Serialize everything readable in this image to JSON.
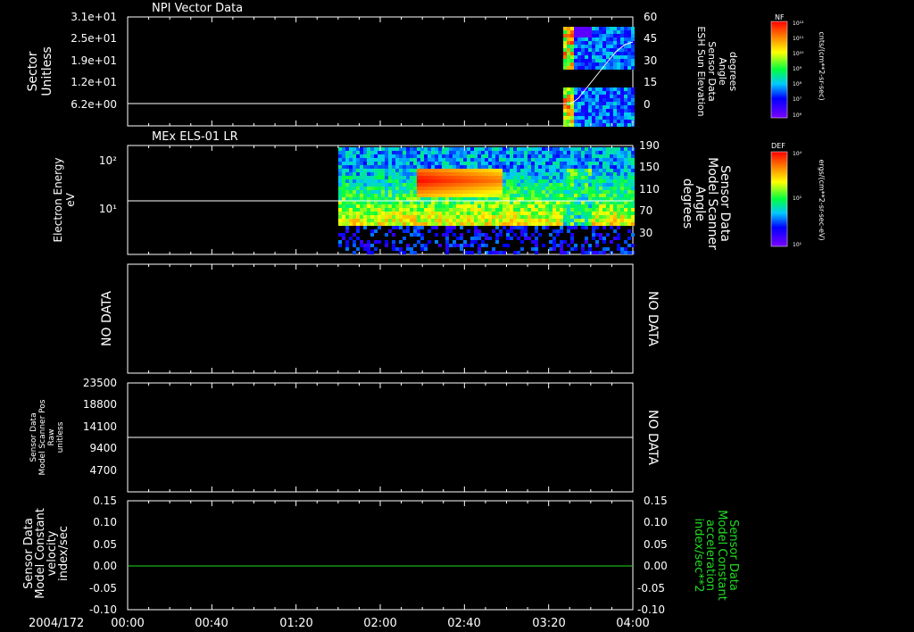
{
  "date_label": "2004/172",
  "time_ticks": [
    "00:00",
    "00:40",
    "01:20",
    "02:00",
    "02:40",
    "03:20",
    "04:00"
  ],
  "colors": {
    "background": "#000000",
    "axes": "#ffffff",
    "green_series": "#22dd22"
  },
  "colorbars": [
    {
      "tag": "NF",
      "units": "cnts/(cm**2-sr-sec)",
      "ticks": [
        "10¹²",
        "10¹¹",
        "10¹⁰",
        "10⁹",
        "10⁸",
        "10⁷",
        "10⁶"
      ]
    },
    {
      "tag": "DEF",
      "units": "ergs/(cm**2-sr-sec-eV)",
      "ticks": [
        "10⁴",
        "10²",
        "10¹"
      ]
    }
  ],
  "panels": [
    {
      "title": "NPI Vector Data",
      "ylabel": [
        "Sector",
        "Unitless"
      ],
      "yticks": [
        "3.1e+01",
        "2.5e+01",
        "1.9e+01",
        "1.2e+01",
        "6.2e+00"
      ],
      "right_label": [
        "ESH Sun Elevation",
        "Sensor Data",
        "Angle",
        "degrees"
      ],
      "right_ticks": [
        "60",
        "45",
        "30",
        "15",
        "0"
      ]
    },
    {
      "title": "MEx ELS-01 LR",
      "ylabel": [
        "Electron Energy",
        "eV"
      ],
      "yticks": [
        "10²",
        "10¹"
      ],
      "right_label": [
        "Sensor Data",
        "Model Scanner",
        "Angle",
        "degrees"
      ],
      "right_ticks": [
        "190",
        "150",
        "110",
        "70",
        "30"
      ]
    },
    {
      "title": "",
      "ylabel": [
        "NO DATA"
      ],
      "right_label": [
        "NO DATA"
      ]
    },
    {
      "title": "",
      "ylabel": [
        "Sensor Data",
        "Model Scanner Pos",
        "Raw",
        "unitless"
      ],
      "yticks": [
        "23500",
        "18800",
        "14100",
        "9400",
        "4700"
      ],
      "right_label": [
        "NO DATA"
      ]
    },
    {
      "title": "",
      "ylabel": [
        "Sensor Data",
        "Model Constant",
        "velocity",
        "index/sec"
      ],
      "yticks": [
        "0.15",
        "0.10",
        "0.05",
        "0.00",
        "-0.05",
        "-0.10"
      ],
      "right_label": [
        "Sensor Data",
        "Model Constant",
        "acceleration",
        "index/sec**2"
      ],
      "right_ticks": [
        "0.15",
        "0.10",
        "0.05",
        "0.00",
        "-0.05",
        "-0.10"
      ]
    }
  ],
  "chart_data": [
    {
      "type": "line",
      "title": "NPI Vector Data",
      "xlabel": "2004/172",
      "x_range": [
        "00:00",
        "04:00"
      ],
      "series": [
        {
          "name": "ESH Sun Elevation",
          "x": [
            "00:00",
            "01:20",
            "02:00",
            "03:30",
            "03:40",
            "03:50",
            "04:00"
          ],
          "y": [
            0,
            0,
            0,
            0,
            12,
            30,
            48
          ]
        }
      ],
      "spectrogram_segment": {
        "x_start": "03:30",
        "x_end": "04:00"
      }
    },
    {
      "type": "heatmap",
      "title": "MEx ELS-01 LR",
      "ylabel": "Electron Energy (eV)",
      "y_scale": "log",
      "data_x_start": "01:32",
      "data_x_end": "04:00",
      "series": [
        {
          "name": "Sensor Data Model Scanner Angle",
          "x": [
            "00:00",
            "04:00"
          ],
          "y": [
            88,
            88
          ]
        }
      ]
    },
    {
      "type": "line",
      "title": "",
      "ylabel": "Sensor Data Model Scanner Pos Raw unitless",
      "ylim": [
        0,
        23500
      ],
      "series": [
        {
          "name": "Sensor Data Model Scanner Pos",
          "x": [
            "00:00",
            "04:00"
          ],
          "y": [
            11500,
            11500
          ]
        }
      ]
    },
    {
      "type": "line",
      "title": "",
      "ylim": [
        -0.1,
        0.15
      ],
      "series": [
        {
          "name": "Sensor Data Model Constant acceleration",
          "x": [
            "00:00",
            "04:00"
          ],
          "y": [
            0,
            0
          ]
        }
      ]
    }
  ]
}
